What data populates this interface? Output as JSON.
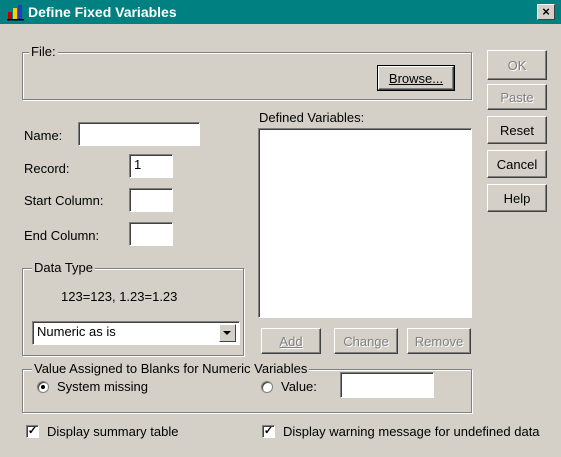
{
  "window": {
    "title": "Define Fixed Variables",
    "close": "×"
  },
  "file_group": {
    "legend": "File:",
    "browse_label": "Browse..."
  },
  "side_buttons": {
    "ok": "OK",
    "paste": "Paste",
    "reset": "Reset",
    "cancel": "Cancel",
    "help": "Help"
  },
  "fields": {
    "name_label": "Name:",
    "name_value": "",
    "record_label": "Record:",
    "record_value": "1",
    "start_label": "Start Column:",
    "start_value": "",
    "end_label": "End Column:",
    "end_value": ""
  },
  "defined": {
    "label": "Defined Variables:",
    "items": []
  },
  "list_buttons": {
    "add": "Add",
    "change": "Change",
    "remove": "Remove"
  },
  "data_type": {
    "legend": "Data Type",
    "example": "123=123, 1.23=1.23",
    "selected": "Numeric as is"
  },
  "blanks": {
    "legend": "Value Assigned to Blanks for Numeric Variables",
    "system_missing": "System missing",
    "value_label": "Value:",
    "value": "",
    "selected": "system_missing"
  },
  "options": {
    "summary_label": "Display summary table",
    "summary_checked": true,
    "warning_label": "Display warning message for undefined data",
    "warning_checked": true
  }
}
